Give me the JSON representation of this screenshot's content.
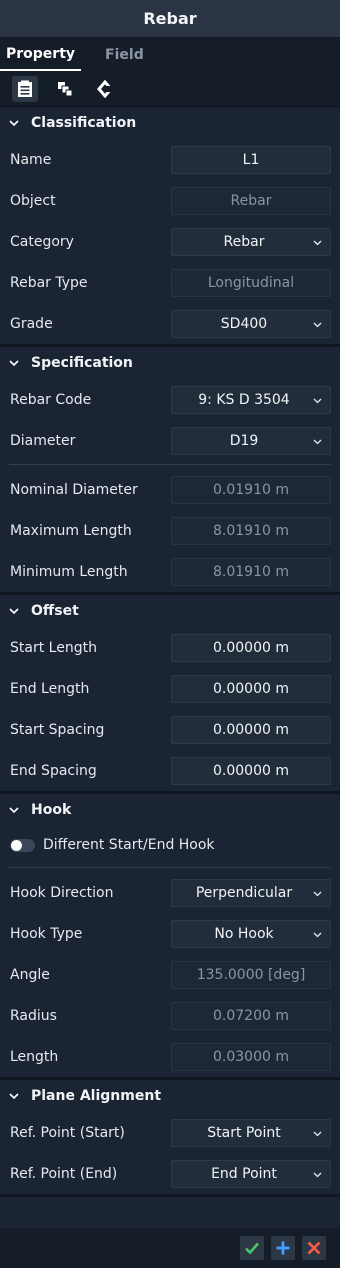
{
  "window": {
    "title": "Rebar"
  },
  "tabs": [
    {
      "label": "Property",
      "active": true
    },
    {
      "label": "Field",
      "active": false
    }
  ],
  "toolbar": {
    "icons": [
      "property-sheet-icon",
      "copy-layers-icon",
      "refresh-icon"
    ]
  },
  "classification": {
    "header": "Classification",
    "name_label": "Name",
    "name_value": "L1",
    "object_label": "Object",
    "object_value": "Rebar",
    "category_label": "Category",
    "category_value": "Rebar",
    "rebar_type_label": "Rebar Type",
    "rebar_type_value": "Longitudinal",
    "grade_label": "Grade",
    "grade_value": "SD400"
  },
  "specification": {
    "header": "Specification",
    "rebar_code_label": "Rebar Code",
    "rebar_code_value": "9: KS D 3504",
    "diameter_label": "Diameter",
    "diameter_value": "D19",
    "nominal_diameter_label": "Nominal Diameter",
    "nominal_diameter_value": "0.01910 m",
    "maximum_length_label": "Maximum Length",
    "maximum_length_value": "8.01910 m",
    "minimum_length_label": "Minimum Length",
    "minimum_length_value": "8.01910 m"
  },
  "offset": {
    "header": "Offset",
    "start_length_label": "Start Length",
    "start_length_value": "0.00000 m",
    "end_length_label": "End Length",
    "end_length_value": "0.00000 m",
    "start_spacing_label": "Start Spacing",
    "start_spacing_value": "0.00000 m",
    "end_spacing_label": "End Spacing",
    "end_spacing_value": "0.00000 m"
  },
  "hook": {
    "header": "Hook",
    "toggle_label": "Different Start/End Hook",
    "toggle_on": false,
    "hook_direction_label": "Hook Direction",
    "hook_direction_value": "Perpendicular",
    "hook_type_label": "Hook Type",
    "hook_type_value": "No Hook",
    "angle_label": "Angle",
    "angle_value": "135.0000 [deg]",
    "radius_label": "Radius",
    "radius_value": "0.07200 m",
    "length_label": "Length",
    "length_value": "0.03000 m"
  },
  "plane_alignment": {
    "header": "Plane Alignment",
    "ref_start_label": "Ref. Point (Start)",
    "ref_start_value": "Start Point",
    "ref_end_label": "Ref. Point (End)",
    "ref_end_value": "End Point"
  },
  "footer": {
    "buttons": [
      "confirm-icon",
      "add-icon",
      "close-icon"
    ]
  },
  "colors": {
    "background": "#1a2433",
    "confirm": "#4cc46a",
    "add": "#3fa3ff",
    "close": "#ff5a4a"
  }
}
